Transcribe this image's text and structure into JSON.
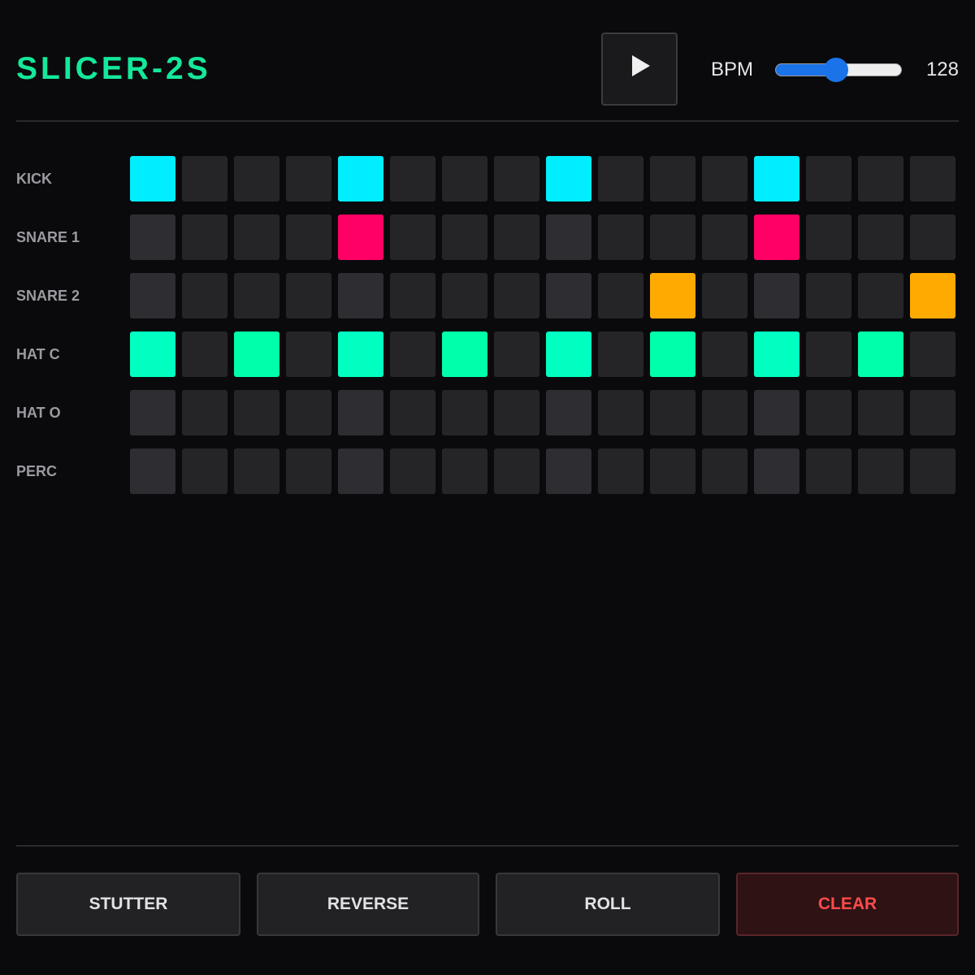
{
  "header": {
    "title": "SLICER-2S",
    "play_icon": "play-icon",
    "bpm_label": "BPM",
    "bpm_value": "128",
    "bpm_slider_fraction": 0.48,
    "accent": "#14e89a",
    "slider_color": "#1a73e8"
  },
  "tracks": [
    {
      "label": "KICK",
      "color": "#00eeff",
      "steps": [
        1,
        0,
        0,
        0,
        1,
        0,
        0,
        0,
        1,
        0,
        0,
        0,
        1,
        0,
        0,
        0
      ]
    },
    {
      "label": "SNARE 1",
      "color": "#ff0066",
      "steps": [
        0,
        0,
        0,
        0,
        1,
        0,
        0,
        0,
        0,
        0,
        0,
        0,
        1,
        0,
        0,
        0
      ]
    },
    {
      "label": "SNARE 2",
      "color": "#ffaa00",
      "steps": [
        0,
        0,
        0,
        0,
        0,
        0,
        0,
        0,
        0,
        0,
        1,
        0,
        0,
        0,
        0,
        1
      ]
    },
    {
      "label": "HAT C",
      "color": "#00ffaa",
      "accent_color": "#00ffc0",
      "steps": [
        1,
        0,
        1,
        0,
        1,
        0,
        1,
        0,
        1,
        0,
        1,
        0,
        1,
        0,
        1,
        0
      ]
    },
    {
      "label": "HAT O",
      "color": "#00ffaa",
      "steps": [
        0,
        0,
        0,
        0,
        0,
        0,
        0,
        0,
        0,
        0,
        0,
        0,
        0,
        0,
        0,
        0
      ]
    },
    {
      "label": "PERC",
      "color": "#b36bff",
      "steps": [
        0,
        0,
        0,
        0,
        0,
        0,
        0,
        0,
        0,
        0,
        0,
        0,
        0,
        0,
        0,
        0
      ]
    }
  ],
  "step_colors": {
    "off": "#252528",
    "off_beat": "#2e2e32"
  },
  "actions": [
    {
      "label": "STUTTER",
      "name": "stutter-button",
      "danger": false
    },
    {
      "label": "REVERSE",
      "name": "reverse-button",
      "danger": false
    },
    {
      "label": "ROLL",
      "name": "roll-button",
      "danger": false
    },
    {
      "label": "CLEAR",
      "name": "clear-button",
      "danger": true
    }
  ]
}
